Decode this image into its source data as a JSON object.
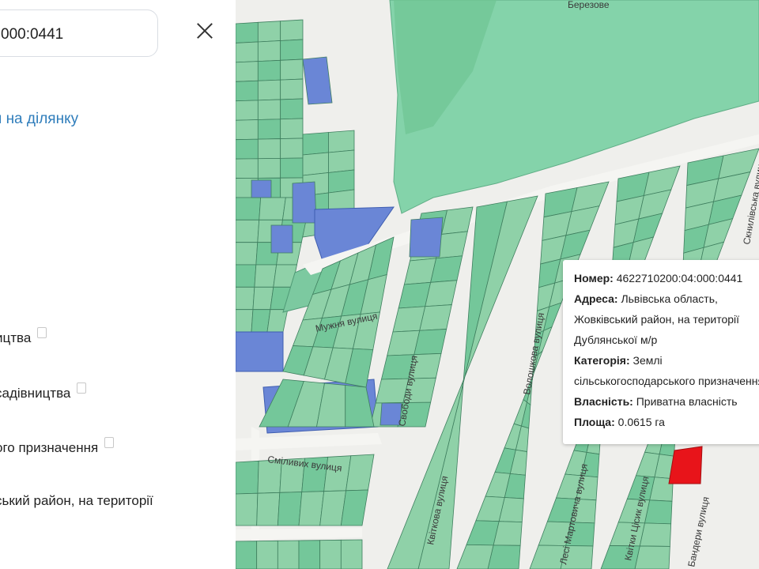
{
  "search": {
    "value": "000:0441"
  },
  "panel": {
    "link_text": "я на ділянку",
    "items": [
      {
        "text": "ицтва",
        "has_copy": true
      },
      {
        "text": "садівництва",
        "has_copy": true
      },
      {
        "text": "ого призначення",
        "has_copy": true
      },
      {
        "text": "ський район, на території",
        "has_copy": false
      }
    ]
  },
  "map": {
    "colors": {
      "parcel": "#8fd1a8",
      "parcel_alt": "#74c79a",
      "selected": "#e8141a",
      "blue": "#6a86d6",
      "forest": "#84d3aa",
      "road": "#f3f3f0"
    },
    "streets": [
      "Мужня вулиця",
      "Свободи вулиця",
      "Сміливих вулиця",
      "Квіткова вулиця",
      "Волошкова вулиця",
      "Лесі Мартовича вулиця",
      "Квітки Цісик вулиця",
      "Бандери вулиця",
      "Скнилівська вулиця",
      "Березове"
    ],
    "popup": {
      "number_label": "Номер:",
      "number_value": "4622710200:04:000:0441",
      "address_label": "Адреса:",
      "address_line1": "Львівська область,",
      "address_line2": "Жовківський район, на території",
      "address_line3": "Дублянської м/р",
      "category_label": "Категорія:",
      "category_line1": "Землі",
      "category_line2": "сільськогосподарського призначення",
      "ownership_label": "Власність:",
      "ownership_value": "Приватна власність",
      "area_label": "Площа:",
      "area_value": "0.0615 га"
    }
  }
}
